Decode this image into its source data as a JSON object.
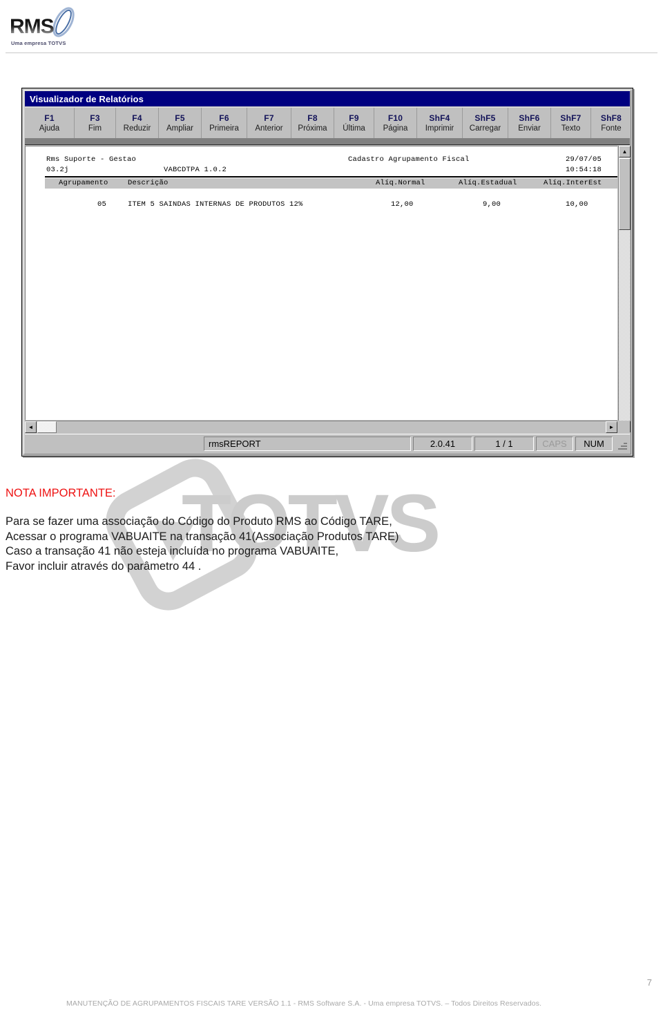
{
  "header": {
    "logo_word": "RMS",
    "logo_tagline": "Uma empresa TOTVS"
  },
  "window": {
    "title": "Visualizador de Relatórios",
    "toolbar": [
      {
        "key": "F1",
        "label": "Ajuda"
      },
      {
        "key": "F3",
        "label": "Fim"
      },
      {
        "key": "F4",
        "label": "Reduzir"
      },
      {
        "key": "F5",
        "label": "Ampliar"
      },
      {
        "key": "F6",
        "label": "Primeira"
      },
      {
        "key": "F7",
        "label": "Anterior"
      },
      {
        "key": "F8",
        "label": "Próxima"
      },
      {
        "key": "F9",
        "label": "Última"
      },
      {
        "key": "F10",
        "label": "Página"
      },
      {
        "key": "ShF4",
        "label": "Imprimir"
      },
      {
        "key": "ShF5",
        "label": "Carregar"
      },
      {
        "key": "ShF6",
        "label": "Enviar"
      },
      {
        "key": "ShF7",
        "label": "Texto"
      },
      {
        "key": "ShF8",
        "label": "Fonte"
      }
    ],
    "report": {
      "company": "Rms Suporte - Gestao",
      "version_left": "03.2j",
      "program": "VABCDTPA 1.0.2",
      "report_title": "Cadastro Agrupamento Fiscal",
      "date": "29/07/05",
      "time": "10:54:18",
      "columns": {
        "col1": "Agrupamento",
        "col2": "Descrição",
        "col3": "Alíq.Normal",
        "col4": "Alíq.Estadual",
        "col5": "Alíq.InterEst"
      },
      "rows": [
        {
          "agrupamento": "05",
          "descricao": "ITEM 5 SAINDAS INTERNAS DE PRODUTOS 12%",
          "aliq_normal": "12,00",
          "aliq_estadual": "9,00",
          "aliq_interest": "10,00"
        }
      ]
    },
    "statusbar": {
      "app": "rmsREPORT",
      "version": "2.0.41",
      "page": "1 / 1",
      "caps": "CAPS",
      "num": "NUM"
    },
    "scroll": {
      "up_arrow": "▲",
      "down_arrow": "▼",
      "left_arrow": "◄",
      "right_arrow": "►"
    }
  },
  "note": {
    "title": "NOTA IMPORTANTE:",
    "lines": [
      "Para se fazer uma associação do Código do Produto RMS ao Código TARE,",
      "Acessar o programa VABUAITE na transação 41(Associação Produtos TARE)",
      "Caso a transação 41 não esteja incluída no programa VABUAITE,",
      "Favor incluir através do parâmetro 44 ."
    ],
    "title_color": "#ee1111",
    "watermark_text": "TOTVS"
  },
  "footer": {
    "page_number": "7",
    "text": "MANUTENÇÃO DE AGRUPAMENTOS FISCAIS TARE VERSÃO 1.1 - RMS Software S.A.  - Uma empresa TOTVS. – Todos Direitos Reservados."
  }
}
